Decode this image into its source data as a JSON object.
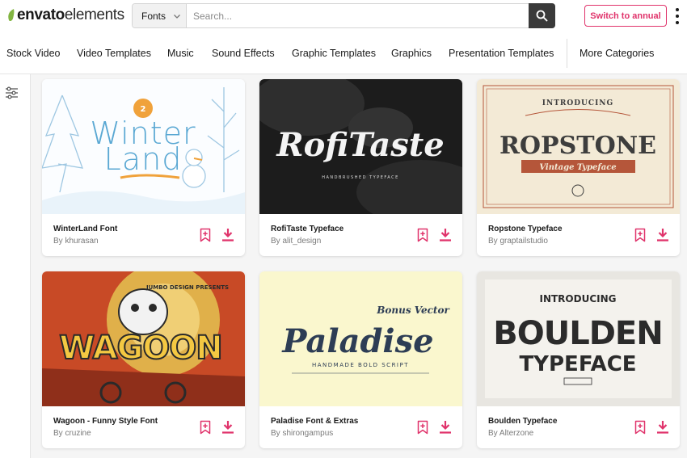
{
  "brand": {
    "logo_bold": "envato",
    "logo_light": "elements"
  },
  "search": {
    "category": "Fonts",
    "placeholder": "Search..."
  },
  "header": {
    "cta_label": "Switch to annual"
  },
  "nav": {
    "items": [
      "Stock Video",
      "Video Templates",
      "Music",
      "Sound Effects",
      "Graphic Templates",
      "Graphics",
      "Presentation Templates"
    ],
    "more_label": "More Categories"
  },
  "colors": {
    "accent": "#e0336b",
    "brand_green": "#82b541",
    "search_button": "#3a3a3a"
  },
  "cards": [
    {
      "title": "WinterLand Font",
      "author": "By khurasan",
      "thumb_line1": "Winter",
      "thumb_line2": "Land"
    },
    {
      "title": "RofiTaste Typeface",
      "author": "By alit_design",
      "thumb_line1": "RofiTaste",
      "thumb_line2": "HANDBRUSHED TYPEFACE"
    },
    {
      "title": "Ropstone Typeface",
      "author": "By graptailstudio",
      "thumb_line1": "INTRODUCING",
      "thumb_line2": "ROPSTONE",
      "thumb_line3": "Vintage Typeface"
    },
    {
      "title": "Wagoon - Funny Style Font",
      "author": "By cruzine",
      "thumb_line1": "WAGOON",
      "thumb_line2": "JUMBO DESIGN PRESENTS"
    },
    {
      "title": "Paladise Font & Extras",
      "author": "By shirongampus",
      "thumb_line1": "Paladise",
      "thumb_line2": "HANDMADE BOLD SCRIPT",
      "thumb_line3": "Bonus Vector"
    },
    {
      "title": "Boulden Typeface",
      "author": "By Alterzone",
      "thumb_line1": "INTRODUCING",
      "thumb_line2": "BOULDEN",
      "thumb_line3": "TYPEFACE"
    }
  ]
}
